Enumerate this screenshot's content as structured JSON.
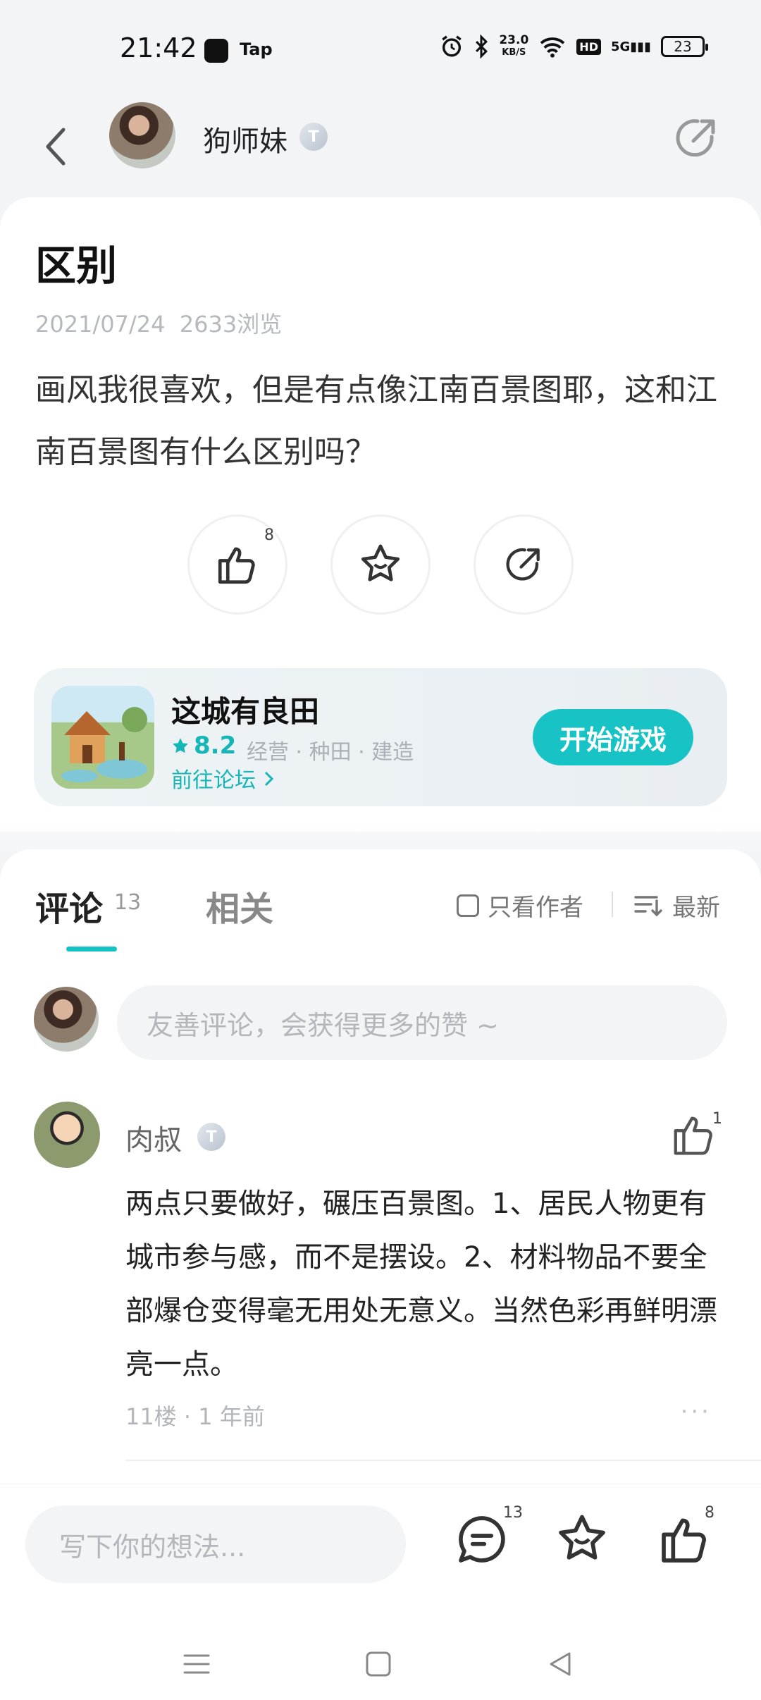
{
  "status_bar": {
    "time": "21:42",
    "app_label": "Tap",
    "net_speed_value": "23.0",
    "net_speed_unit": "KB/S",
    "hd": "HD",
    "signal": "5G",
    "battery": "23"
  },
  "header": {
    "author_name": "狗师妹",
    "badge": "T"
  },
  "post": {
    "title": "区别",
    "date": "2021/07/24",
    "views": "2633浏览",
    "body": "画风我很喜欢，但是有点像江南百景图耶，这和江南百景图有什么区别吗？",
    "like_count": "8"
  },
  "game": {
    "name": "这城有良田",
    "rating": "8.2",
    "tags": "经营 · 种田 · 建造",
    "forum_link": "前往论坛",
    "play_button": "开始游戏"
  },
  "comments": {
    "tab_comment": "评论",
    "tab_comment_count": "13",
    "tab_related": "相关",
    "only_author": "只看作者",
    "sort_latest": "最新",
    "input_placeholder": "友善评论，会获得更多的赞 ~",
    "items": [
      {
        "name": "肉叔",
        "badge": "T",
        "like_count": "1",
        "text": "两点只要做好，碾压百景图。1、居民人物更有城市参与感，而不是摆设。2、材料物品不要全部爆仓变得毫无用处无意义。当然色彩再鲜明漂亮一点。",
        "floor_time": "11楼 · 1 年前",
        "more": "···"
      }
    ]
  },
  "bottom_bar": {
    "input_placeholder": "写下你的想法...",
    "comment_count": "13",
    "like_count": "8"
  },
  "colors": {
    "accent": "#17c0c3",
    "background": "#f2f4f6",
    "text_muted": "#b3b7bc"
  },
  "icons": [
    "back-icon",
    "share-icon",
    "like-icon",
    "star-icon",
    "comment-icon",
    "chevron-right-icon",
    "sort-icon",
    "menu-nav-icon",
    "home-nav-icon",
    "back-nav-icon"
  ]
}
